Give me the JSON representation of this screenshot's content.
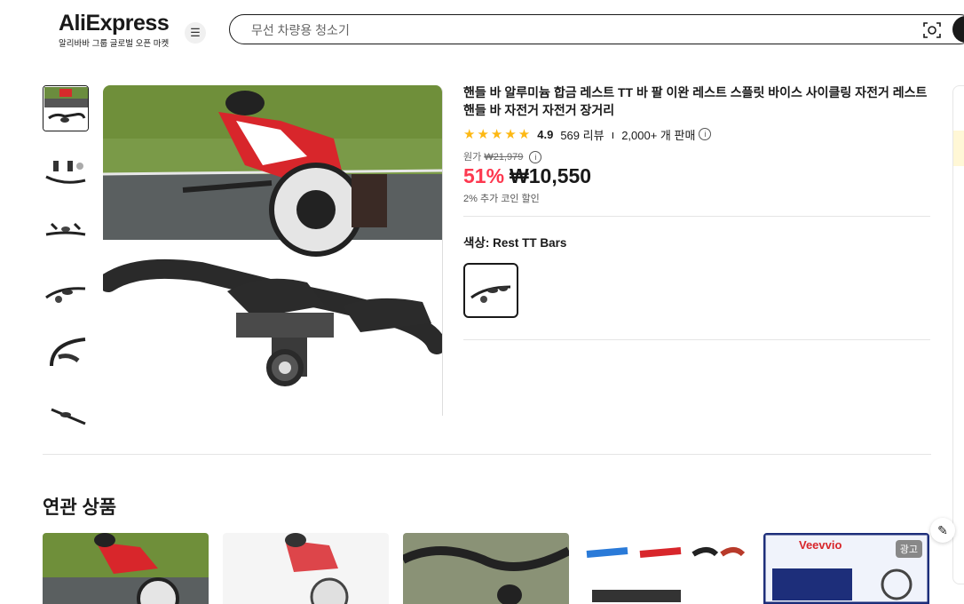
{
  "header": {
    "logo_text": "AliExpress",
    "logo_sub": "알리바바 그룹 글로벌 오픈 마켓",
    "search_placeholder": "무선 차량용 청소기"
  },
  "product": {
    "title": "핸들 바 알루미늄 합금 레스트 TT 바 팔 이완 레스트 스플릿 바이스 사이클링 자전거 레스트 핸들 바 자전거 자전거 장거리",
    "rating": "4.9",
    "reviews": "569 리뷰",
    "separator": "ı",
    "sold": "2,000+ 개 판매",
    "original_label": "원가",
    "original_price": "₩21,979",
    "discount": "51%",
    "price": "₩10,550",
    "coin_note": "2% 추가 코인 할인",
    "color_label": "색상: Rest TT Bars"
  },
  "related": {
    "title": "연관 상품",
    "ad_badge": "광고",
    "ad_brand": "Veevvio"
  },
  "colors": {
    "accent": "#fd384f",
    "star": "#fdb813",
    "text": "#191919"
  }
}
